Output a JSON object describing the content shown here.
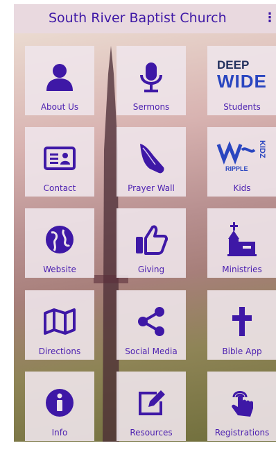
{
  "app": {
    "title": "South River Baptist Church",
    "menu_glyph": "⋮"
  },
  "tiles": [
    {
      "label": "About Us",
      "icon": "person-icon"
    },
    {
      "label": "Sermons",
      "icon": "microphone-icon"
    },
    {
      "label": "Students",
      "icon": "deep-wide-logo",
      "logo_lines": [
        "DEEP",
        "WIDE"
      ]
    },
    {
      "label": "Contact",
      "icon": "contact-card-icon"
    },
    {
      "label": "Prayer Wall",
      "icon": "praying-hands-icon"
    },
    {
      "label": "Kids",
      "icon": "ripple-kidz-logo",
      "logo_lines": [
        "RIPPLE",
        "KIDZ"
      ]
    },
    {
      "label": "Website",
      "icon": "globe-icon"
    },
    {
      "label": "Giving",
      "icon": "thumbs-up-icon"
    },
    {
      "label": "Ministries",
      "icon": "church-icon"
    },
    {
      "label": "Directions",
      "icon": "map-icon"
    },
    {
      "label": "Social Media",
      "icon": "share-icon"
    },
    {
      "label": "Bible App",
      "icon": "cross-icon"
    },
    {
      "label": "Info",
      "icon": "info-icon"
    },
    {
      "label": "Resources",
      "icon": "edit-icon"
    },
    {
      "label": "Registrations",
      "icon": "touch-icon"
    }
  ],
  "colors": {
    "accent": "#3e18a6",
    "tile": "#eee4ea",
    "header": "#e9d9df"
  }
}
